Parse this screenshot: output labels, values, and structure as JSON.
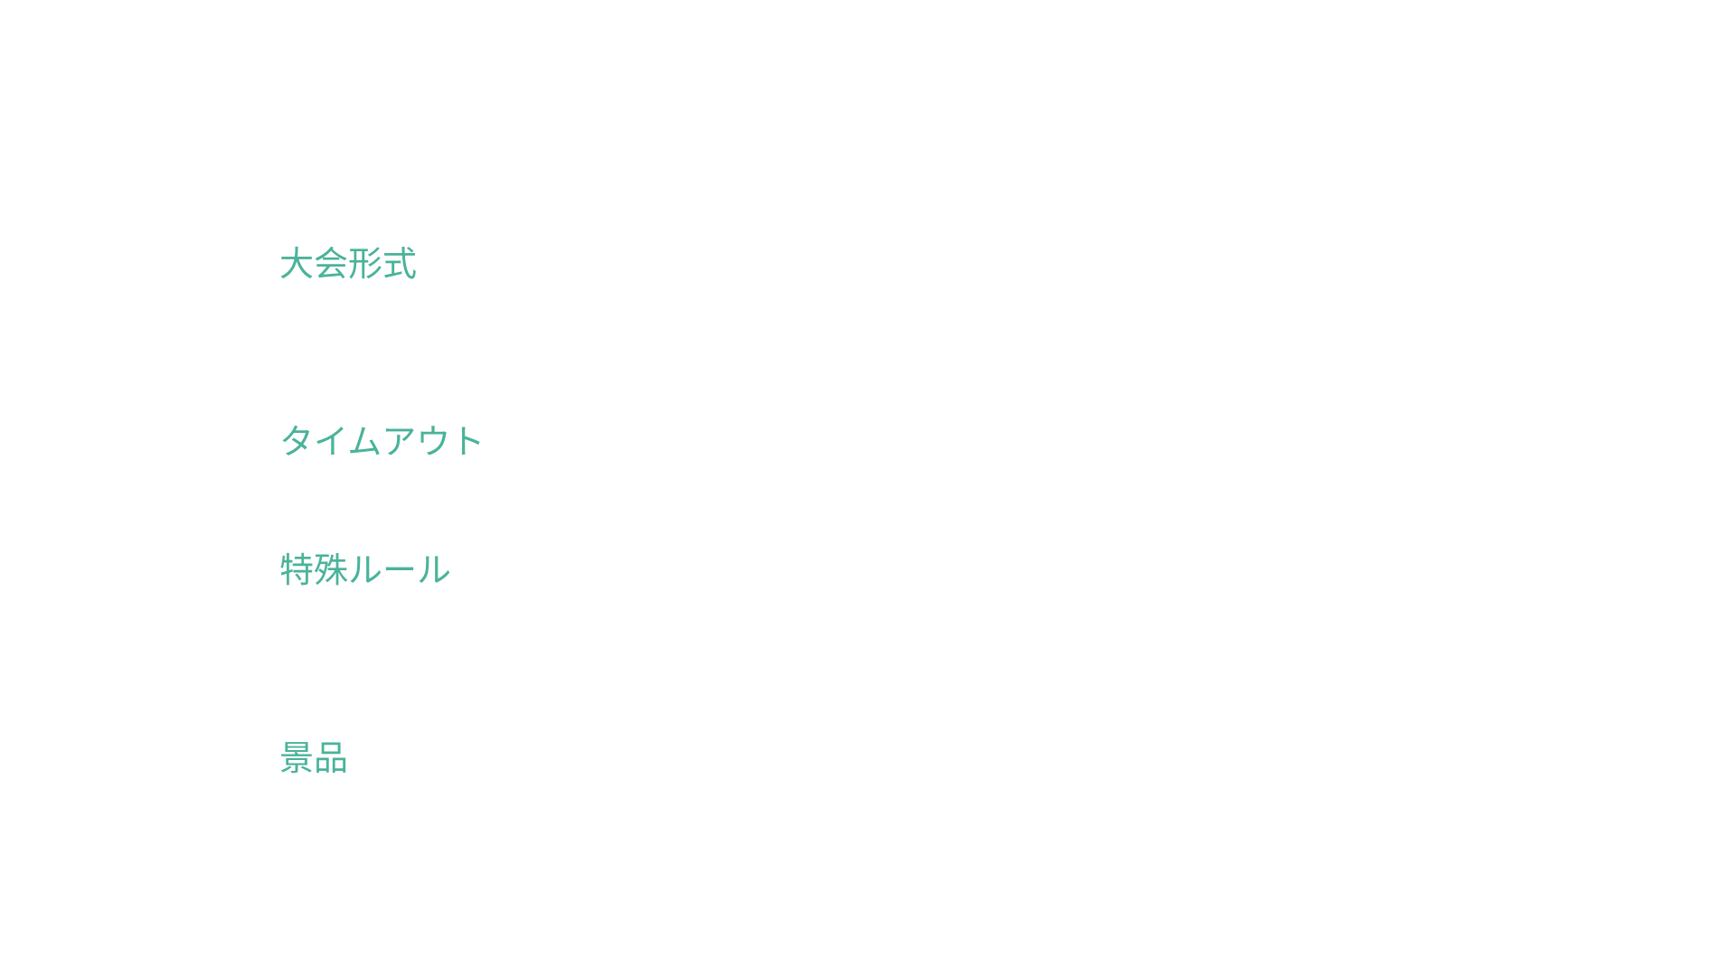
{
  "sections": {
    "tournament_format": {
      "label": "大会形式"
    },
    "timeout": {
      "label": "タイムアウト"
    },
    "special_rules": {
      "label": "特殊ルール"
    },
    "prizes": {
      "label": "景品"
    }
  },
  "colors": {
    "background": "#ffffff",
    "label_text": "#4ab39a"
  }
}
